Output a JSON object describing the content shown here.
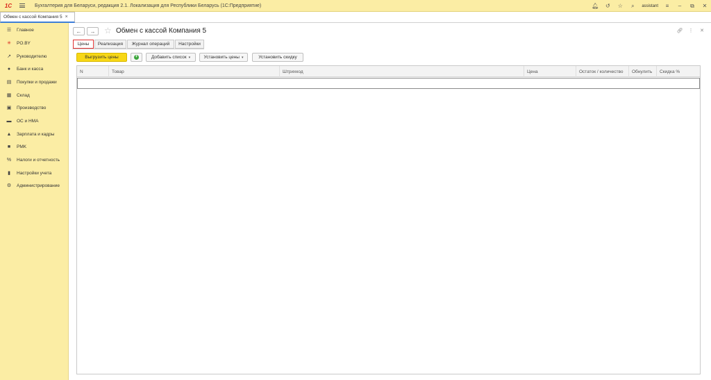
{
  "titlebar": {
    "logo": "1C",
    "title": "Бухгалтерия для Беларуси, редакция 2.1. Локализация для Республики Беларусь   (1С:Предприятие)",
    "user": "assistant",
    "icons": [
      "bell-icon",
      "history-icon",
      "star-icon",
      "search-icon",
      "settings-menu-icon",
      "minimize-icon",
      "restore-icon",
      "close-icon"
    ]
  },
  "open_tab": {
    "label": "Обмен с кассой Компания 5",
    "close": "×"
  },
  "sidebar": {
    "items": [
      {
        "label": "Главное",
        "icon": "menu-lines-icon"
      },
      {
        "label": "PO.BY",
        "icon": "asterisk-icon"
      },
      {
        "label": "Руководителю",
        "icon": "trend-icon"
      },
      {
        "label": "Банк и касса",
        "icon": "coin-icon"
      },
      {
        "label": "Покупки и продажи",
        "icon": "cart-icon"
      },
      {
        "label": "Склад",
        "icon": "warehouse-icon"
      },
      {
        "label": "Производство",
        "icon": "factory-icon"
      },
      {
        "label": "ОС и НМА",
        "icon": "truck-icon"
      },
      {
        "label": "Зарплата и кадры",
        "icon": "person-icon"
      },
      {
        "label": "PMK",
        "icon": "terminal-icon"
      },
      {
        "label": "Налоги и отчетность",
        "icon": "percent-icon"
      },
      {
        "label": "Настройки учета",
        "icon": "book-icon"
      },
      {
        "label": "Администрирование",
        "icon": "gear-icon"
      }
    ]
  },
  "form": {
    "title": "Обмен с кассой Компания 5",
    "tabs": [
      {
        "label": "Цены",
        "active": true
      },
      {
        "label": "Реализация",
        "active": false
      },
      {
        "label": "Журнал операций",
        "active": false
      },
      {
        "label": "Настройки",
        "active": false
      }
    ],
    "toolbar": {
      "upload_prices": "Выгрузить цены",
      "add_list": "Добавить список",
      "set_prices": "Установить цены",
      "set_discount": "Установить скидку"
    },
    "table": {
      "columns": [
        "N",
        "Товар",
        "Штрихкод",
        "Цена",
        "Остаток / количество",
        "Обнулить",
        "Скидка %"
      ],
      "rows": []
    }
  },
  "colors": {
    "sidebar_bg": "#fbeda4",
    "primary_button": "#f7d716",
    "active_tab_border": "#e03131",
    "add_icon": "#3ca63c"
  }
}
